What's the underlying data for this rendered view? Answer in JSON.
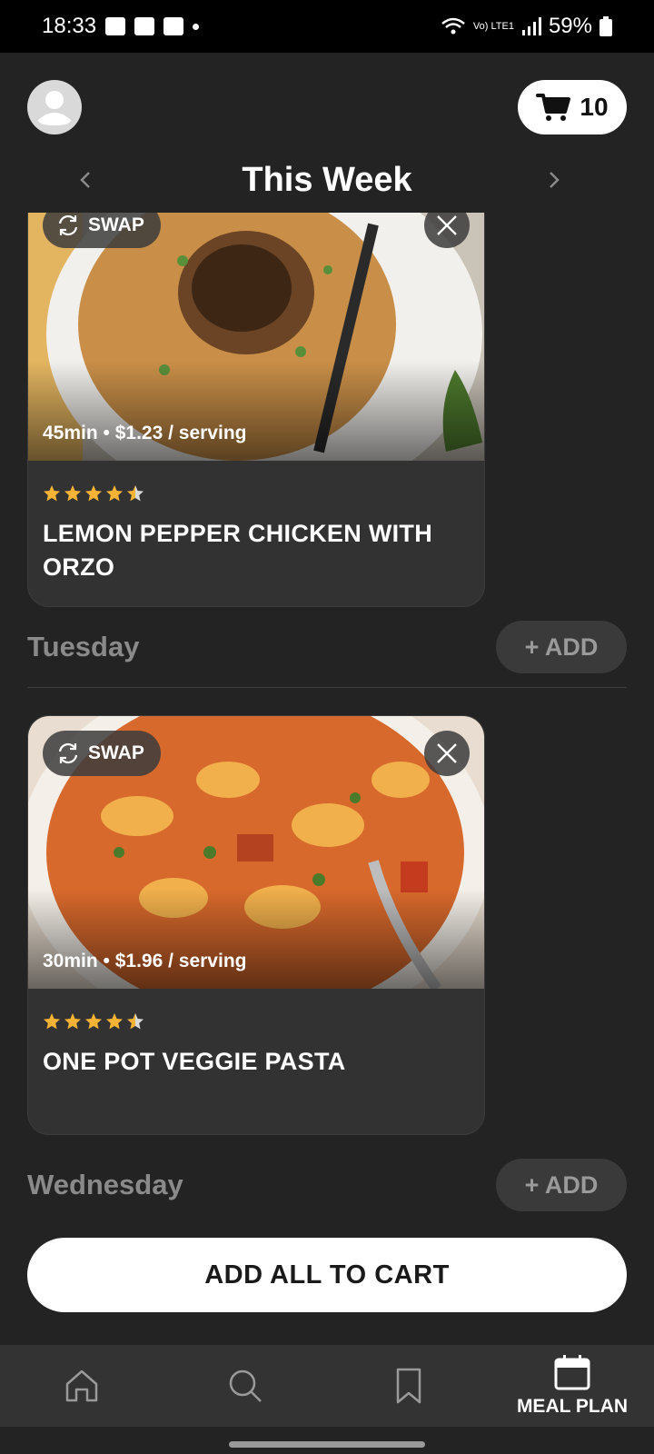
{
  "status_bar": {
    "time": "18:33",
    "network_label": "Vo) LTE1",
    "battery": "59%"
  },
  "header": {
    "cart_count": "10",
    "week_title": "This Week"
  },
  "meals": [
    {
      "meta": "45min • $1.23 / serving",
      "title": "LEMON PEPPER CHICKEN WITH ORZO",
      "rating": 4.5,
      "swap_label": "SWAP"
    },
    {
      "meta": "30min • $1.96 / serving",
      "title": "ONE POT VEGGIE PASTA",
      "rating": 4.5,
      "swap_label": "SWAP"
    }
  ],
  "days": [
    {
      "label": "Tuesday",
      "add_label": "+ ADD"
    },
    {
      "label": "Wednesday",
      "add_label": "+ ADD"
    }
  ],
  "add_all_label": "ADD ALL TO CART",
  "bottom_nav": {
    "items": [
      {
        "icon": "home-icon",
        "label": ""
      },
      {
        "icon": "search-icon",
        "label": ""
      },
      {
        "icon": "bookmark-icon",
        "label": ""
      },
      {
        "icon": "calendar-icon",
        "label": "MEAL PLAN",
        "active": true
      }
    ]
  },
  "colors": {
    "background": "#232323",
    "card": "#323232",
    "star": "#f5b335",
    "muted_text": "#8a8a8a"
  }
}
